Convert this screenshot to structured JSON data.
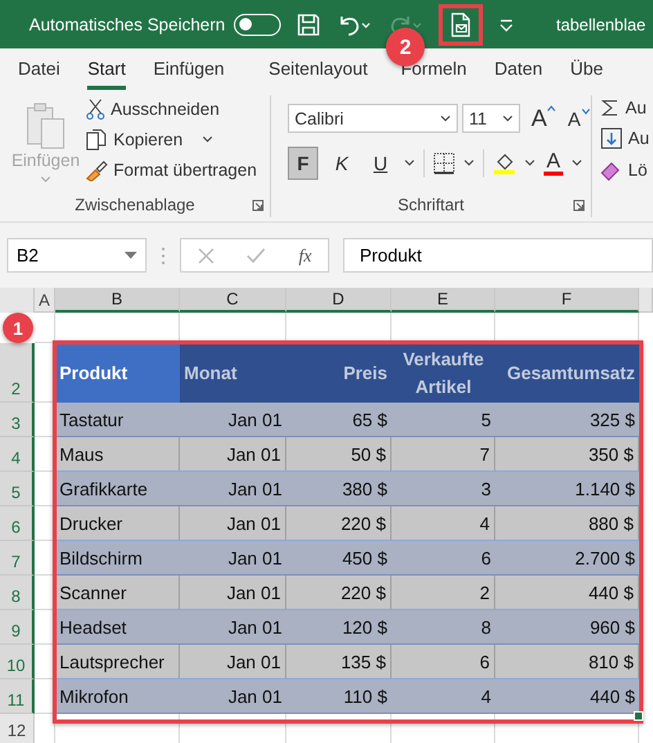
{
  "title_bar": {
    "autosave_label": "Automatisches Speichern",
    "autosave": {
      "on": false
    },
    "file_name": "tabellenblae"
  },
  "tabs": [
    {
      "label": "Datei",
      "selected": false
    },
    {
      "label": "Start",
      "selected": true
    },
    {
      "label": "Einfügen",
      "selected": false
    },
    {
      "label": "Seitenlayout",
      "selected": false
    },
    {
      "label": "Formeln",
      "selected": false
    },
    {
      "label": "Daten",
      "selected": false
    },
    {
      "label": "Übe",
      "selected": false
    }
  ],
  "clipboard": {
    "label": "Zwischenablage",
    "paste_label": "Einfügen",
    "paste_disabled": true,
    "cut": "Ausschneiden",
    "copy": "Kopieren",
    "format_painter": "Format übertragen"
  },
  "font": {
    "label": "Schriftart",
    "family": "Calibri",
    "size": "11",
    "grow": "A",
    "shrink": "A",
    "font_color": "A",
    "format_buttons": [
      {
        "label": "F",
        "on": true
      },
      {
        "label": "K",
        "on": false
      },
      {
        "label": "U",
        "on": false
      }
    ]
  },
  "editing": [
    "Au",
    "Au",
    "Lö"
  ],
  "formula_bar": {
    "name_box": "B2",
    "fx": "fx",
    "content": "Produkt"
  },
  "column_headers": [
    {
      "label": "A",
      "selected": false
    },
    {
      "label": "B",
      "selected": true
    },
    {
      "label": "C",
      "selected": true
    },
    {
      "label": "D",
      "selected": true
    },
    {
      "label": "E",
      "selected": true
    },
    {
      "label": "F",
      "selected": true
    }
  ],
  "row_headers": [
    {
      "label": "2",
      "selected": true
    },
    {
      "label": "3",
      "selected": true
    },
    {
      "label": "4",
      "selected": true
    },
    {
      "label": "5",
      "selected": true
    },
    {
      "label": "6",
      "selected": true
    },
    {
      "label": "7",
      "selected": true
    },
    {
      "label": "8",
      "selected": true
    },
    {
      "label": "9",
      "selected": true
    },
    {
      "label": "10",
      "selected": true
    },
    {
      "label": "11",
      "selected": true
    },
    {
      "label": "12",
      "selected": false
    }
  ],
  "table": {
    "selected": true,
    "columns": [
      "Produkt",
      "Monat",
      "Preis",
      "Verkaufte Artikel",
      "Gesamtumsatz"
    ],
    "rows": [
      [
        "Tastatur",
        "Jan 01",
        "65 $",
        "5",
        "325 $"
      ],
      [
        "Maus",
        "Jan 01",
        "50 $",
        "7",
        "350 $"
      ],
      [
        "Grafikkarte",
        "Jan 01",
        "380 $",
        "3",
        "1.140 $"
      ],
      [
        "Drucker",
        "Jan 01",
        "220 $",
        "4",
        "880 $"
      ],
      [
        "Bildschirm",
        "Jan 01",
        "450 $",
        "6",
        "2.700 $"
      ],
      [
        "Scanner",
        "Jan 01",
        "220 $",
        "2",
        "440 $"
      ],
      [
        "Headset",
        "Jan 01",
        "120 $",
        "8",
        "960 $"
      ],
      [
        "Lautsprecher",
        "Jan 01",
        "135 $",
        "6",
        "810 $"
      ],
      [
        "Mikrofon",
        "Jan 01",
        "110 $",
        "4",
        "440 $"
      ]
    ]
  },
  "callouts": [
    "1",
    "2"
  ]
}
